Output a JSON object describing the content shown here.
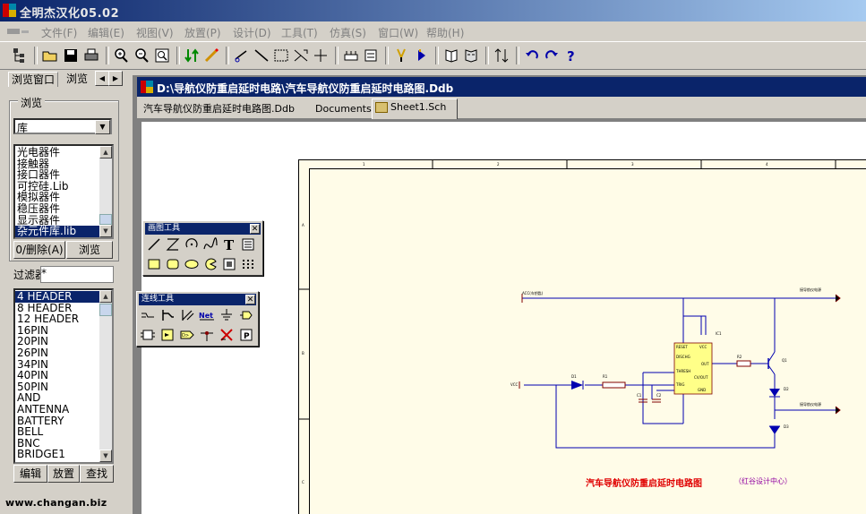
{
  "app": {
    "title": "全明杰汉化05.02"
  },
  "menu": [
    "文件(F)",
    "编辑(E)",
    "视图(V)",
    "放置(P)",
    "设计(D)",
    "工具(T)",
    "仿真(S)",
    "窗口(W)",
    "帮助(H)"
  ],
  "panel": {
    "tabs": [
      "浏览窗口",
      "浏览"
    ],
    "group_label": "浏览",
    "combo_value": "库",
    "libraries": [
      "光电器件",
      "接触器",
      "接口器件",
      "可控硅.Lib",
      "模拟器件",
      "稳压器件",
      "显示器件",
      "杂元件库.lib"
    ],
    "selected_library": 7,
    "add_remove_button": "0/删除(A)",
    "browse_button": "浏览",
    "filter_label": "过滤器",
    "filter_value": "*",
    "components": [
      "4 HEADER",
      "8 HEADER",
      "12 HEADER",
      "16PIN",
      "20PIN",
      "26PIN",
      "34PIN",
      "40PIN",
      "50PIN",
      "AND",
      "ANTENNA",
      "BATTERY",
      "BELL",
      "BNC",
      "BRIDGE1"
    ],
    "selected_component": 0,
    "edit_button": "编辑",
    "place_button": "放置",
    "find_button": "查找"
  },
  "document": {
    "title": "D:\\导航仪防重启延时电路\\汽车导航仪防重启延时电路图.Ddb",
    "tabs": [
      "汽车导航仪防重启延时电路图.Ddb",
      "Documents",
      "Sheet1.Sch"
    ],
    "active_tab": 2
  },
  "palettes": {
    "drawing_title": "画图工具",
    "wiring_title": "连线工具"
  },
  "schematic": {
    "title": "汽车导航仪防重启延时电路图",
    "note": "（红谷设计中心）",
    "top_left_label": "ACC(车钥匙)",
    "top_right_label": "接导航仪电源",
    "ic_pins_left": [
      "RESET",
      "DISCHG",
      "THRESH",
      "TRIG"
    ],
    "ic_pins_right": [
      "VCC",
      "OUT",
      "CV/OUT",
      "GND"
    ],
    "labels": [
      "D1",
      "R1",
      "R2",
      "C1",
      "C2",
      "Q1",
      "D2",
      "D3",
      "IC1",
      "VCC"
    ]
  },
  "watermark": "www.changan.biz"
}
